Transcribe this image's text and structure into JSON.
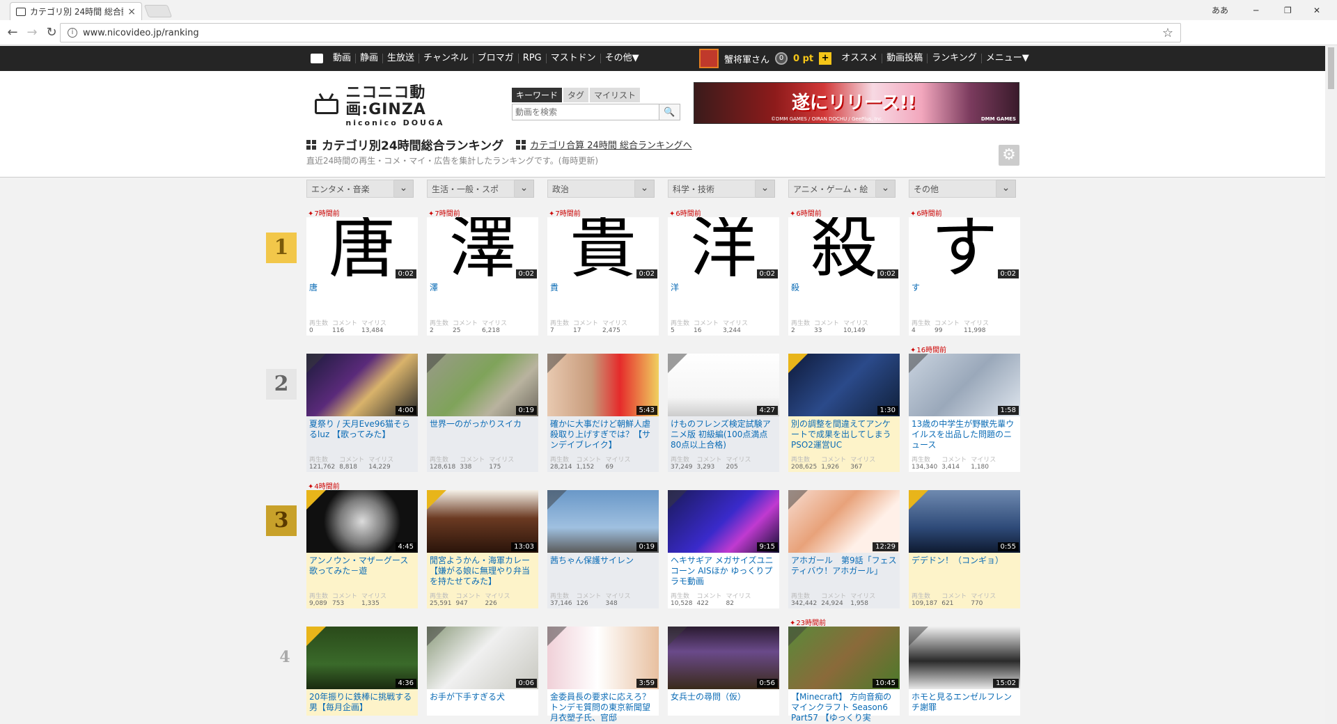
{
  "browser": {
    "tab_title": "カテゴリ別 24時間 総合動...",
    "tab_close": "×",
    "url": "www.nicovideo.jp/ranking",
    "window_user": "ああ",
    "minimize": "─",
    "maximize": "❐",
    "close": "✕",
    "back": "←",
    "forward": "→",
    "reload": "↻",
    "info": "i",
    "bookmark": "☆"
  },
  "sitebar": {
    "left_items": [
      "動画",
      "静画",
      "生放送",
      "チャンネル",
      "ブロマガ",
      "RPG",
      "マストドン",
      "その他▼"
    ],
    "user_name": "蟹将軍さん",
    "coins": "0",
    "points": "0 pt",
    "plus": "+",
    "right_items": [
      "オススメ",
      "動画投稿",
      "ランキング",
      "メニュー▼"
    ]
  },
  "header": {
    "logo_main": "ニコニコ動画:GINZA",
    "logo_sub": "niconico DOUGA",
    "search_tabs": [
      "キーワード",
      "タグ",
      "マイリスト"
    ],
    "search_placeholder": "動画を検索",
    "search_button": "🔍",
    "banner_text": "遂にリリース!!",
    "banner_small": "©DMM GAMES / OIRAN DOCHU / GeePlus, Inc.",
    "banner_brand": "DMM GAMES",
    "page_title": "カテゴリ別24時間総合ランキング",
    "sub_link": "カテゴリ合算 24時間 総合ランキングへ",
    "description": "直近24時間の再生・コメ・マイ・広告を集計したランキングです。(毎時更新)",
    "gear": "⚙"
  },
  "categories": [
    "エンタメ・音楽",
    "生活・一般・スポ",
    "政治",
    "科学・技術",
    "アニメ・ゲーム・絵",
    "その他"
  ],
  "dropdown_icon": "⌄",
  "stat_labels": [
    "再生数",
    "コメント",
    "マイリス"
  ],
  "ranks": [
    "1",
    "2",
    "3",
    "4"
  ],
  "rows": [
    [
      {
        "kanji": "唐",
        "time": "7時間前",
        "dur": "0:02",
        "title": "唐",
        "views": "0",
        "comments": "116",
        "mylist": "13,484"
      },
      {
        "kanji": "澤",
        "time": "7時間前",
        "dur": "0:02",
        "title": "澤",
        "views": "2",
        "comments": "25",
        "mylist": "6,218"
      },
      {
        "kanji": "貴",
        "time": "7時間前",
        "dur": "0:02",
        "title": "貴",
        "views": "7",
        "comments": "17",
        "mylist": "2,475"
      },
      {
        "kanji": "洋",
        "time": "6時間前",
        "dur": "0:02",
        "title": "洋",
        "views": "5",
        "comments": "16",
        "mylist": "3,244"
      },
      {
        "kanji": "殺",
        "time": "6時間前",
        "dur": "0:02",
        "title": "殺",
        "views": "2",
        "comments": "33",
        "mylist": "10,149"
      },
      {
        "kanji": "す",
        "time": "6時間前",
        "dur": "0:02",
        "title": "す",
        "views": "4",
        "comments": "99",
        "mylist": "11,998"
      }
    ],
    [
      {
        "time": "",
        "dur": "4:00",
        "title": "夏祭り / 天月Eve96猫そらるluz 【歌ってみた】",
        "views": "121,762",
        "comments": "8,818",
        "mylist": "14,229",
        "bg": "linear-gradient(135deg,#1b1b3a,#5a2a7a 40%,#d9b36b 60%,#2a2a2a)"
      },
      {
        "time": "",
        "dur": "0:19",
        "title": "世界一のがっかりスイカ",
        "views": "128,618",
        "comments": "338",
        "mylist": "175",
        "bg": "linear-gradient(135deg,#9a9a8a,#7fa35a 45%,#b9b39f 70%,#6f6a5f)"
      },
      {
        "time": "",
        "dur": "5:43",
        "title": "確かに大事だけど朝鮮人虐殺取り上げすぎでは？【サンデイブレイク】",
        "views": "28,214",
        "comments": "1,152",
        "mylist": "69",
        "bg": "linear-gradient(90deg,#e8c9b0,#c79a7a 40%,#e52b2b 65%,#f0d060)"
      },
      {
        "time": "",
        "dur": "4:27",
        "title": "けものフレンズ検定試験アニメ版 初級編(100点満点 80点以上合格)",
        "views": "37,249",
        "comments": "3,293",
        "mylist": "205",
        "bg": "linear-gradient(180deg,#ffffff,#f5f5f5 70%,#cccccc)"
      },
      {
        "time": "",
        "dur": "1:30",
        "title": "別の調整を間違えてアンケートで成果を出してしまうPSO2運営UC",
        "views": "208,625",
        "comments": "1,926",
        "mylist": "367",
        "bg": "linear-gradient(135deg,#0e1a3a,#2b4a8a 50%,#10203a)"
      },
      {
        "time": "16時間前",
        "dur": "1:58",
        "title": "13歳の中学生が野獣先輩ウイルスを出品した問題のニュース",
        "views": "134,340",
        "comments": "3,414",
        "mylist": "1,180",
        "bg": "linear-gradient(135deg,#c9d3df,#9aa8ba 50%,#dfe6ee)"
      }
    ],
    [
      {
        "time": "4時間前",
        "dur": "4:45",
        "title": "アンノウン・マザーグース　歌ってみた－遊",
        "views": "9,089",
        "comments": "753",
        "mylist": "1,335",
        "bg": "radial-gradient(circle at 50% 50%,#dcdcdc,#7a7a7a 35%,#101010 60%)"
      },
      {
        "time": "",
        "dur": "13:03",
        "title": "閒宮ようかん・海軍カレー【嫌がる娘に無理やり弁当を持たせてみた】",
        "views": "25,591",
        "comments": "947",
        "mylist": "226",
        "bg": "linear-gradient(180deg,#f5f1e8,#6b3a22 45%,#2a140a)"
      },
      {
        "time": "",
        "dur": "0:19",
        "title": "茜ちゃん保護サイレン",
        "views": "37,146",
        "comments": "126",
        "mylist": "348",
        "bg": "linear-gradient(180deg,#6a98c8,#9fc0e0 60%,#5a5a5a)"
      },
      {
        "time": "",
        "dur": "9:15",
        "title": "ヘキサギア メガサイズユニコーン AISほか ゆっくりプラモ動画",
        "views": "10,528",
        "comments": "422",
        "mylist": "82",
        "bg": "linear-gradient(135deg,#1a1a5a,#3a2acb 50%,#c03ad0 70%,#101030)"
      },
      {
        "time": "",
        "dur": "12:29",
        "title": "アホガール　第9話「フェスティバウ！アホガール」",
        "views": "342,442",
        "comments": "24,924",
        "mylist": "1,958",
        "bg": "linear-gradient(135deg,#f7dcd0,#e8a27a 40%,#fff0e8 70%)"
      },
      {
        "time": "",
        "dur": "0:55",
        "title": "デデドン！（コンギョ）",
        "views": "109,187",
        "comments": "621",
        "mylist": "770",
        "bg": "linear-gradient(180deg,#6f8ab0,#2e4a78 60%,#0e1a30)"
      }
    ],
    [
      {
        "time": "",
        "dur": "4:36",
        "title": "20年振りに鉄棒に挑戦する男【毎月企画】",
        "views": "",
        "comments": "",
        "mylist": "",
        "bg": "linear-gradient(180deg,#2a4a1a,#3a6a2a 60%,#1a2a10)"
      },
      {
        "time": "",
        "dur": "0:06",
        "title": "お手が下手すぎる犬",
        "views": "",
        "comments": "",
        "mylist": "",
        "bg": "linear-gradient(135deg,#8a9a7a,#f0f0f0 45%,#c8c8c0)"
      },
      {
        "time": "",
        "dur": "3:59",
        "title": "金委員長の要求に応えろ？トンデモ質問の東京新聞望月衣塑子氏、官邸",
        "views": "",
        "comments": "",
        "mylist": "",
        "bg": "linear-gradient(90deg,#f0d0d8,#ffffff 45%,#e8c0a0)"
      },
      {
        "time": "",
        "dur": "0:56",
        "title": "女兵士の尋問（仮）",
        "views": "",
        "comments": "",
        "mylist": "",
        "bg": "linear-gradient(180deg,#2a1a30,#6a4a8a 40%,#3a2a1a)"
      },
      {
        "time": "23時間前",
        "dur": "10:45",
        "title": "【Minecraft】 方向音痴のマインクラフト Season6 Part57 【ゆっくり実",
        "views": "",
        "comments": "",
        "mylist": "",
        "bg": "linear-gradient(135deg,#5a8a3a,#8a6a3a 50%,#4a7a2a)"
      },
      {
        "time": "",
        "dur": "15:02",
        "title": "ホモと見るエンゼルフレンチ謝罪",
        "views": "",
        "comments": "",
        "mylist": "",
        "bg": "linear-gradient(180deg,#f0f0f0,#2a2a2a 55%,#e8e8e8)"
      }
    ]
  ]
}
